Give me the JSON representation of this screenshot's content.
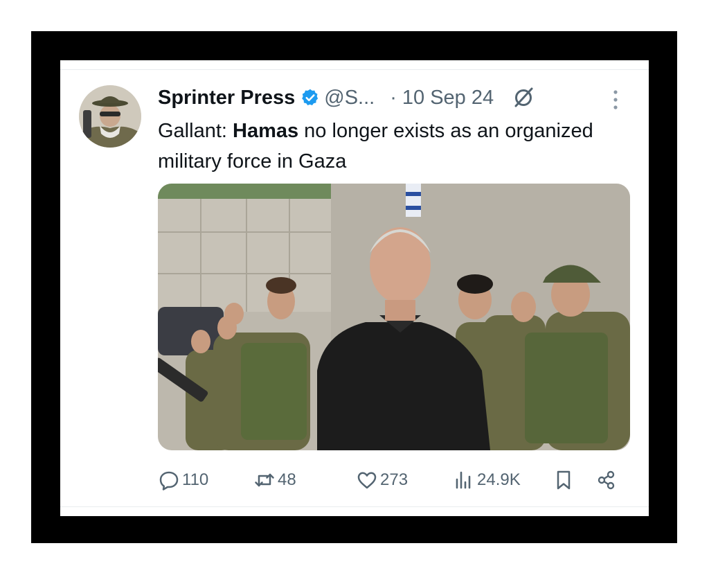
{
  "tweet": {
    "author_name": "Sprinter Press",
    "handle": "@S...",
    "separator": "·",
    "date": "10 Sep 24",
    "text_part1": "Gallant: ",
    "text_bold": "Hamas",
    "text_part2": " no longer exists as an organized military force in Gaza"
  },
  "stats": {
    "replies": "110",
    "reposts": "48",
    "likes": "273",
    "views": "24.9K"
  },
  "icons": {
    "verified": "verified-badge-icon",
    "grok": "grok-icon",
    "more": "more-options-icon",
    "reply": "reply-icon",
    "repost": "repost-icon",
    "like": "like-icon",
    "views": "views-icon",
    "bookmark": "bookmark-icon",
    "share": "share-icon"
  },
  "colors": {
    "text": "#0f1419",
    "secondary": "#536471",
    "verified": "#1d9bf0",
    "frame": "#000000"
  }
}
